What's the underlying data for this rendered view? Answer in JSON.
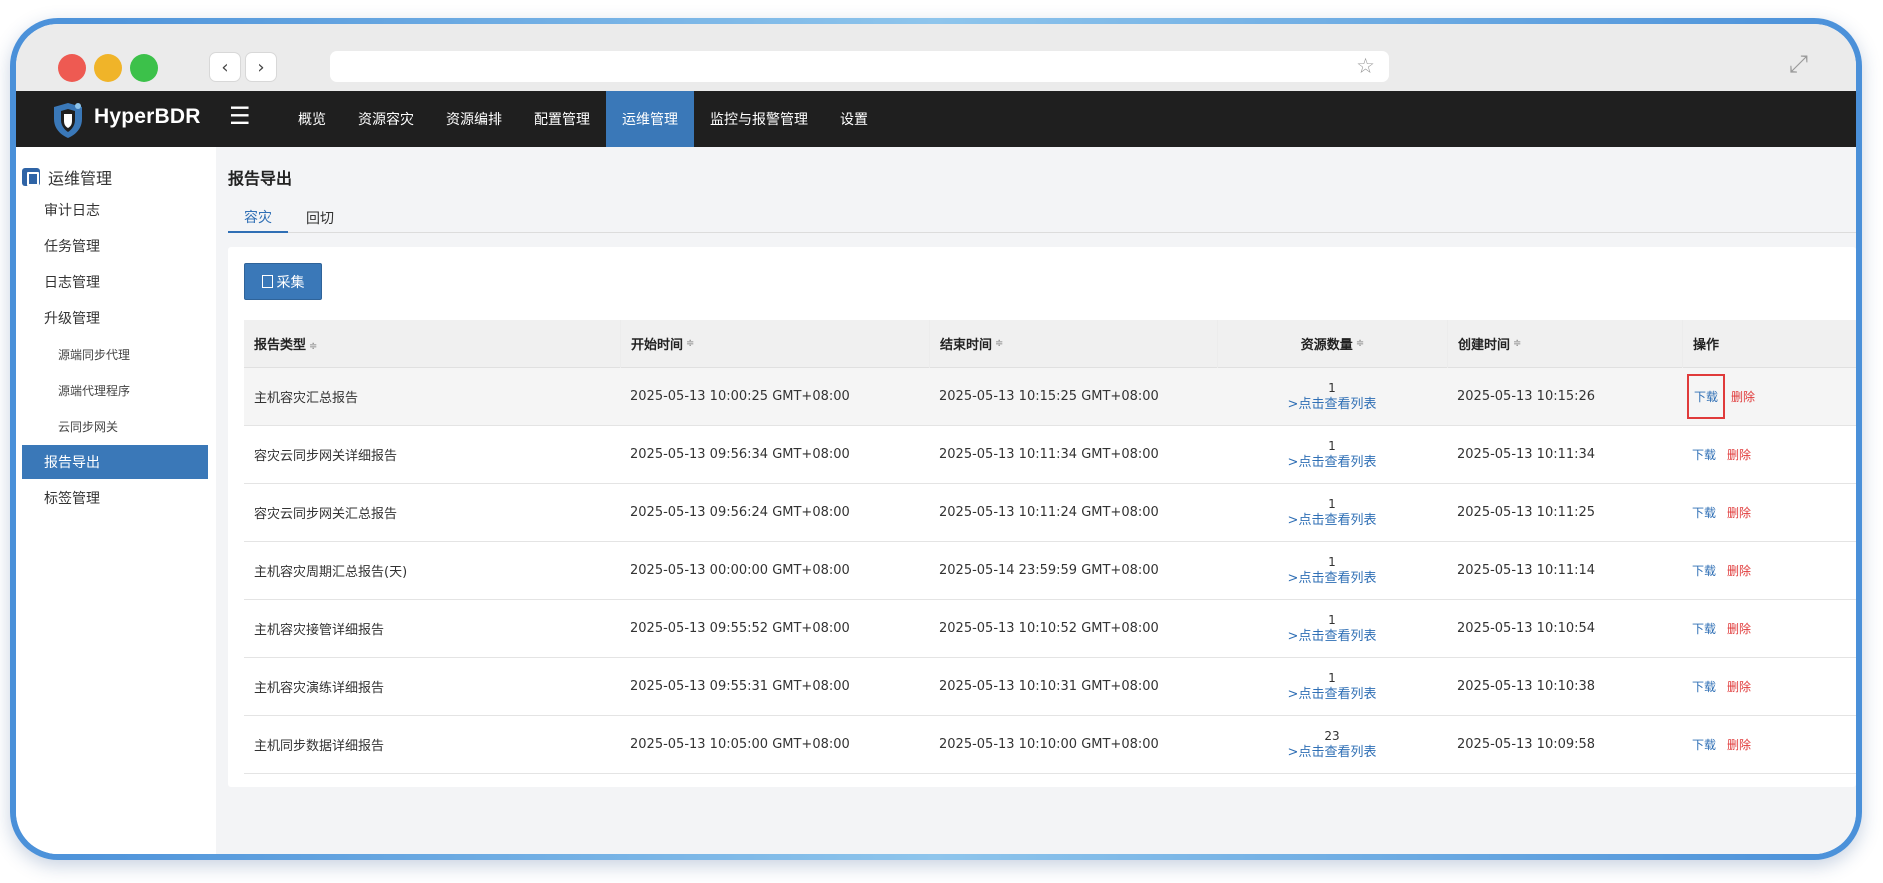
{
  "app": {
    "brand": "HyperBDR",
    "hamburger": "☰",
    "colors": {
      "accent": "#3a78b8",
      "header_bg": "#1f1f1f",
      "danger": "#e03a3a",
      "link": "#2f6fb5"
    }
  },
  "browser": {
    "back_icon": "‹",
    "forward_icon": "›",
    "star_icon": "☆",
    "expand_icon": "⤢"
  },
  "topnav": [
    {
      "label": "概览",
      "active": false
    },
    {
      "label": "资源容灾",
      "active": false
    },
    {
      "label": "资源编排",
      "active": false
    },
    {
      "label": "配置管理",
      "active": false
    },
    {
      "label": "运维管理",
      "active": true
    },
    {
      "label": "监控与报警管理",
      "active": false
    },
    {
      "label": "设置",
      "active": false
    }
  ],
  "sidebar": {
    "header": "运维管理",
    "items": [
      {
        "label": "审计日志"
      },
      {
        "label": "任务管理"
      },
      {
        "label": "日志管理"
      },
      {
        "label": "升级管理"
      },
      {
        "label": "源端同步代理"
      },
      {
        "label": "源端代理程序"
      },
      {
        "label": "云同步网关"
      },
      {
        "label": "报告导出"
      },
      {
        "label": "标签管理"
      }
    ]
  },
  "page": {
    "title": "报告导出",
    "tabs": [
      "容灾",
      "回切"
    ],
    "collect_button": "采集"
  },
  "table": {
    "headers": [
      "报告类型",
      "开始时间",
      "结束时间",
      "资源数量",
      "创建时间",
      "操作"
    ],
    "sort_icon": "≑",
    "view_link": ">点击查看列表",
    "download_label": "下载",
    "delete_label": "删除",
    "rows": [
      {
        "type": "主机容灾汇总报告",
        "start": "2025-05-13 10:00:25 GMT+08:00",
        "end": "2025-05-13 10:15:25 GMT+08:00",
        "count": "1",
        "created": "2025-05-13 10:15:26"
      },
      {
        "type": "容灾云同步网关详细报告",
        "start": "2025-05-13 09:56:34 GMT+08:00",
        "end": "2025-05-13 10:11:34 GMT+08:00",
        "count": "1",
        "created": "2025-05-13 10:11:34"
      },
      {
        "type": "容灾云同步网关汇总报告",
        "start": "2025-05-13 09:56:24 GMT+08:00",
        "end": "2025-05-13 10:11:24 GMT+08:00",
        "count": "1",
        "created": "2025-05-13 10:11:25"
      },
      {
        "type": "主机容灾周期汇总报告(天)",
        "start": "2025-05-13 00:00:00 GMT+08:00",
        "end": "2025-05-14 23:59:59 GMT+08:00",
        "count": "1",
        "created": "2025-05-13 10:11:14"
      },
      {
        "type": "主机容灾接管详细报告",
        "start": "2025-05-13 09:55:52 GMT+08:00",
        "end": "2025-05-13 10:10:52 GMT+08:00",
        "count": "1",
        "created": "2025-05-13 10:10:54"
      },
      {
        "type": "主机容灾演练详细报告",
        "start": "2025-05-13 09:55:31 GMT+08:00",
        "end": "2025-05-13 10:10:31 GMT+08:00",
        "count": "1",
        "created": "2025-05-13 10:10:38"
      },
      {
        "type": "主机同步数据详细报告",
        "start": "2025-05-13 10:05:00 GMT+08:00",
        "end": "2025-05-13 10:10:00 GMT+08:00",
        "count": "23",
        "created": "2025-05-13 10:09:58"
      }
    ]
  }
}
